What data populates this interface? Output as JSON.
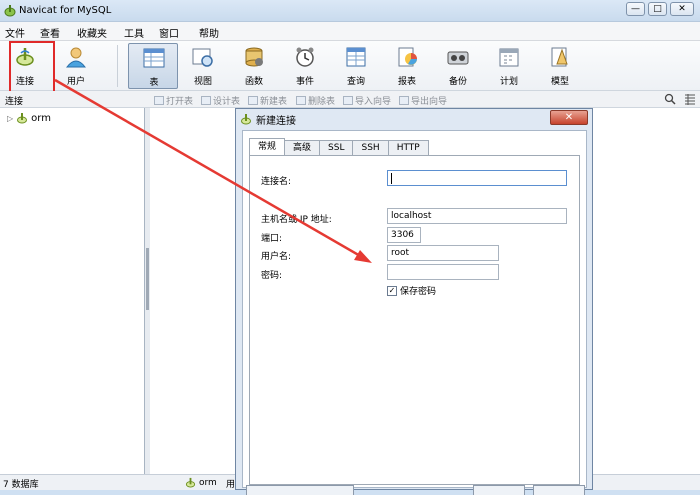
{
  "window": {
    "title": "Navicat for MySQL",
    "buttons": [
      "—",
      "□",
      "✕"
    ]
  },
  "menu": [
    "文件",
    "查看",
    "收藏夹",
    "工具",
    "窗口",
    "帮助"
  ],
  "toolbar": [
    "连接",
    "用户",
    "表",
    "视图",
    "函数",
    "事件",
    "查询",
    "报表",
    "备份",
    "计划",
    "模型"
  ],
  "subbar": {
    "left_label": "连接",
    "actions": [
      "打开表",
      "设计表",
      "新建表",
      "删除表",
      "导入向导",
      "导出向导"
    ]
  },
  "tree": {
    "connection": "orm"
  },
  "status": {
    "db_count": "7 数据库",
    "connection": "orm",
    "extra": "用"
  },
  "dialog": {
    "title": "新建连接",
    "close_label": "✕",
    "tabs": [
      "常规",
      "高级",
      "SSL",
      "SSH",
      "HTTP"
    ],
    "fields": {
      "conn_name_label": "连接名:",
      "conn_name": "",
      "host_label": "主机名或 IP 地址:",
      "host": "localhost",
      "port_label": "端口:",
      "port": "3306",
      "user_label": "用户名:",
      "user": "root",
      "password_label": "密码:",
      "password": ""
    },
    "save_password_label": "保存密码",
    "save_password_checked": true
  },
  "colors": {
    "highlight": "#e02a2a",
    "arrow": "#e53a33"
  },
  "icons": [
    "connection-icon",
    "user-icon",
    "table-icon",
    "view-icon",
    "function-icon",
    "event-icon",
    "query-icon",
    "report-icon",
    "backup-icon",
    "schedule-icon",
    "model-icon",
    "search-icon",
    "grid-icon"
  ]
}
